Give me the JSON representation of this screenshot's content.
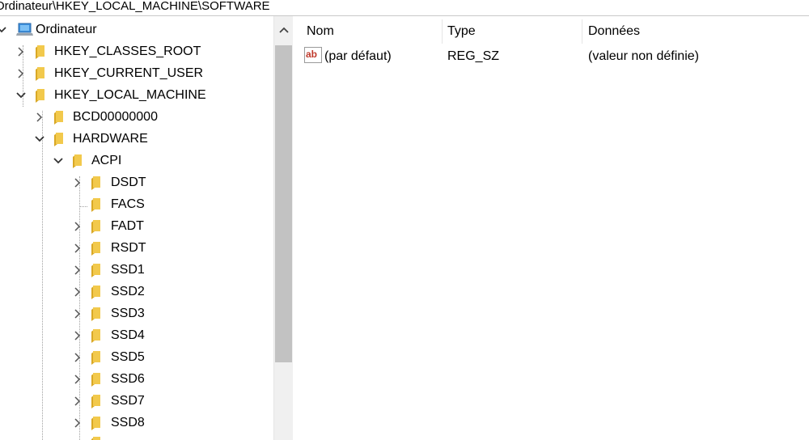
{
  "address_bar": {
    "path": "Ordinateur\\HKEY_LOCAL_MACHINE\\SOFTWARE"
  },
  "tree": {
    "root": {
      "label": "Ordinateur",
      "icon": "computer-icon"
    },
    "hives": [
      {
        "label": "HKEY_CLASSES_ROOT"
      },
      {
        "label": "HKEY_CURRENT_USER"
      },
      {
        "label": "HKEY_LOCAL_MACHINE"
      }
    ],
    "hklm_children": [
      {
        "label": "BCD00000000"
      },
      {
        "label": "HARDWARE"
      }
    ],
    "hardware_children": [
      {
        "label": "ACPI"
      }
    ],
    "acpi_children": [
      {
        "label": "DSDT"
      },
      {
        "label": "FACS"
      },
      {
        "label": "FADT"
      },
      {
        "label": "RSDT"
      },
      {
        "label": "SSD1"
      },
      {
        "label": "SSD2"
      },
      {
        "label": "SSD3"
      },
      {
        "label": "SSD4"
      },
      {
        "label": "SSD5"
      },
      {
        "label": "SSD6"
      },
      {
        "label": "SSD7"
      },
      {
        "label": "SSD8"
      }
    ]
  },
  "list": {
    "columns": {
      "name": "Nom",
      "type": "Type",
      "data": "Données"
    },
    "rows": [
      {
        "name": "(par défaut)",
        "type": "REG_SZ",
        "data": "(valeur non définie)",
        "icon": "string-value-icon"
      }
    ]
  },
  "colors": {
    "folder": "#f2c94c",
    "folder_dark": "#d9a826",
    "scroll_thumb": "#c2c2c2",
    "string_icon_red": "#c0392b"
  }
}
